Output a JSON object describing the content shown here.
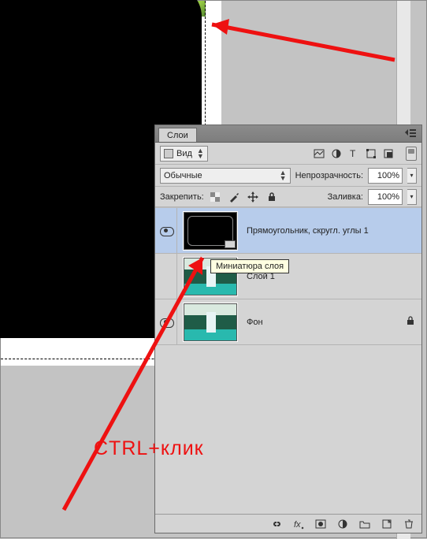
{
  "panel": {
    "tab_label": "Слои",
    "filter": {
      "kind_label": "Вид"
    },
    "blend": {
      "mode": "Обычные",
      "opacity_label": "Непрозрачность:",
      "opacity_value": "100%"
    },
    "lock": {
      "label": "Закрепить:",
      "fill_label": "Заливка:",
      "fill_value": "100%"
    },
    "layers": [
      {
        "name": "Прямоугольник, скругл. углы 1",
        "visible": true,
        "selected": true,
        "type": "shape",
        "locked": false
      },
      {
        "name": "Слой 1",
        "visible": false,
        "selected": false,
        "type": "image",
        "locked": false
      },
      {
        "name": "Фон",
        "visible": true,
        "selected": false,
        "type": "image",
        "locked": true
      }
    ]
  },
  "tooltip": "Миниатюра слоя",
  "annotation": "CTRL+клик"
}
